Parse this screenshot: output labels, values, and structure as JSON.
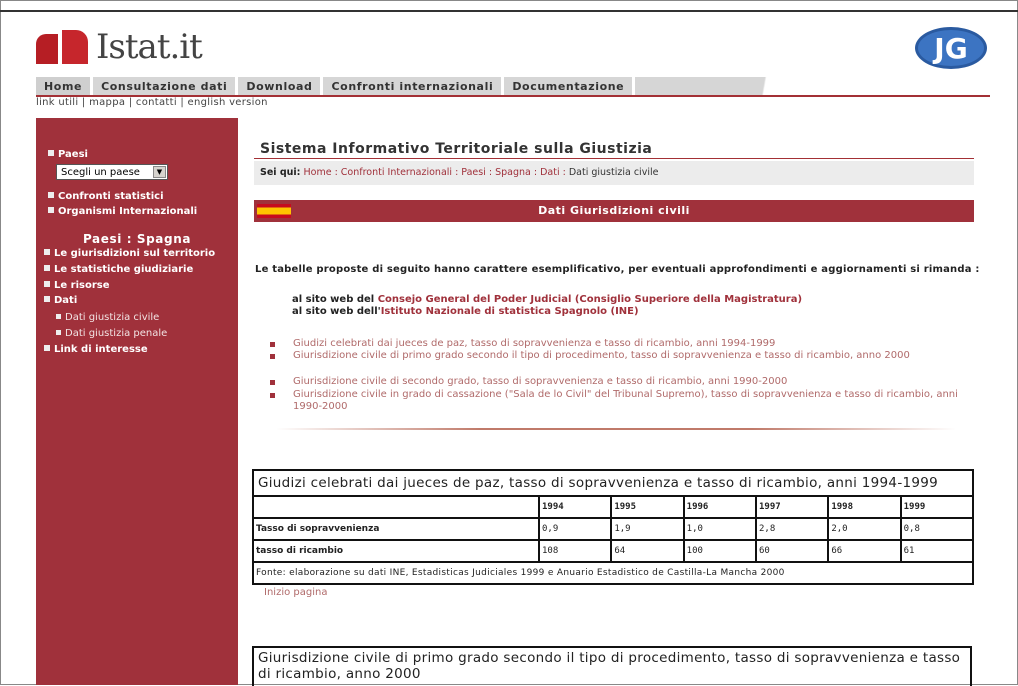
{
  "header": {
    "logo_text": "Istat.it",
    "tabs": [
      "Home",
      "Consultazione dati",
      "Download",
      "Confronti internazionali",
      "Documentazione"
    ],
    "utility_links": "link utili  |  mappa  |  contatti  |  english version"
  },
  "sidebar": {
    "paesi_label": "Paesi",
    "select_value": "Scegli un paese",
    "confronti": "Confronti statistici",
    "organismi": "Organismi Internazionali",
    "heading": "Paesi : Spagna",
    "items": [
      "Le giurisdizioni sul territorio",
      "Le statistiche giudiziarie",
      "Le risorse",
      "Dati"
    ],
    "subitems": [
      "Dati giustizia civile",
      "Dati giustizia penale"
    ],
    "link": "Link di interesse"
  },
  "main": {
    "title": "Sistema Informativo Territoriale sulla Giustizia",
    "breadcrumb_label": "Sei qui:",
    "breadcrumb_links": "Home : Confronti Internazionali : Paesi : Spagna : Dati :",
    "breadcrumb_current": "Dati giustizia civile",
    "banner_title": "Dati Giurisdizioni civili",
    "intro": "Le tabelle proposte di seguito hanno carattere esemplificativo, per eventuali approfondimenti e aggiornamenti si rimanda :",
    "site1_prefix": "al sito web del",
    "site1_link": "Consejo General del Poder Judicial (Consiglio Superiore della Magistratura)",
    "site2_prefix": "al sito web dell'",
    "site2_link": "Istituto Nazionale di statistica Spagnolo (INE)",
    "list": [
      "Giudizi celebrati dai jueces de paz, tasso di sopravvenienza e tasso di ricambio, anni 1994-1999",
      "Giurisdizione civile di primo grado secondo il tipo di procedimento, tasso di sopravvenienza e tasso di ricambio, anno 2000",
      "Giurisdizione civile di secondo grado, tasso di sopravvenienza e tasso di ricambio, anni 1990-2000",
      "Giurisdizione civile in grado di cassazione (\"Sala de lo Civil\" del Tribunal Supremo), tasso di sopravvenienza e tasso di ricambio, anni 1990-2000"
    ],
    "table1": {
      "caption": "Giudizi celebrati dai jueces de paz, tasso di sopravvenienza e tasso di ricambio, anni 1994-1999",
      "years": [
        "1994",
        "1995",
        "1996",
        "1997",
        "1998",
        "1999"
      ],
      "rows": [
        {
          "label": "Tasso di sopravvenienza",
          "values": [
            "0,9",
            "1,9",
            "1,0",
            "2,8",
            "2,0",
            "0,8"
          ]
        },
        {
          "label": "tasso di ricambio",
          "values": [
            "108",
            "64",
            "100",
            "60",
            "66",
            "61"
          ]
        }
      ],
      "source": "Fonte: elaborazione su dati INE, Estadisticas Judiciales 1999 e Anuario Estadistico de Castilla-La Mancha 2000"
    },
    "top_link": "Inizio pagina",
    "table2_caption": "Giurisdizione civile di primo grado secondo il tipo di procedimento, tasso di sopravvenienza e tasso di ricambio, anno 2000"
  }
}
